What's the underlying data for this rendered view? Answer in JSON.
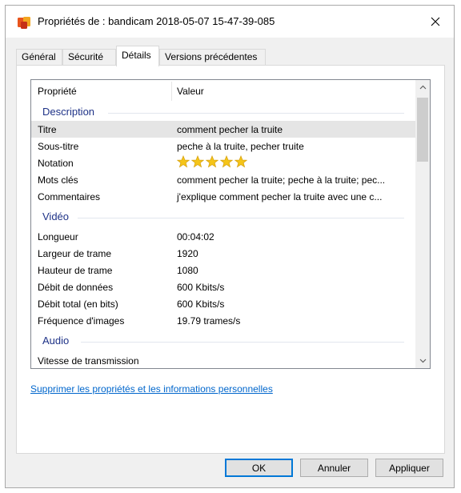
{
  "window": {
    "title": "Propriétés de : bandicam 2018-05-07 15-47-39-085"
  },
  "tabs": [
    {
      "label": "Général"
    },
    {
      "label": "Sécurité"
    },
    {
      "label": "Détails"
    },
    {
      "label": "Versions précédentes"
    }
  ],
  "active_tab": "Détails",
  "list": {
    "col_property": "Propriété",
    "col_value": "Valeur",
    "groups": {
      "description": "Description",
      "video": "Vidéo",
      "audio": "Audio"
    },
    "description_rows": [
      {
        "key": "Titre",
        "value": "comment pecher la truite"
      },
      {
        "key": "Sous-titre",
        "value": "peche à la truite, pecher truite"
      },
      {
        "key": "Notation",
        "value": ""
      },
      {
        "key": "Mots clés",
        "value": "comment pecher la truite; peche à la truite; pec..."
      },
      {
        "key": "Commentaires",
        "value": "j'explique comment pecher la truite avec une c..."
      }
    ],
    "rating": {
      "stars": 5,
      "max": 5
    },
    "video_rows": [
      {
        "key": "Longueur",
        "value": "00:04:02"
      },
      {
        "key": "Largeur de trame",
        "value": "1920"
      },
      {
        "key": "Hauteur de trame",
        "value": "1080"
      },
      {
        "key": "Débit de données",
        "value": "600 Kbits/s"
      },
      {
        "key": "Débit total (en bits)",
        "value": "600 Kbits/s"
      },
      {
        "key": "Fréquence d'images",
        "value": "19.79 trames/s"
      }
    ],
    "audio_rows": [
      {
        "key": "Vitesse de transmission",
        "value": ""
      }
    ]
  },
  "remove_link": "Supprimer les propriétés et les informations personnelles",
  "buttons": {
    "ok": "OK",
    "cancel": "Annuler",
    "apply": "Appliquer"
  },
  "colors": {
    "accent": "#0078d7",
    "group_header": "#1e3287",
    "link": "#0066cc",
    "star": "#f5c518"
  }
}
